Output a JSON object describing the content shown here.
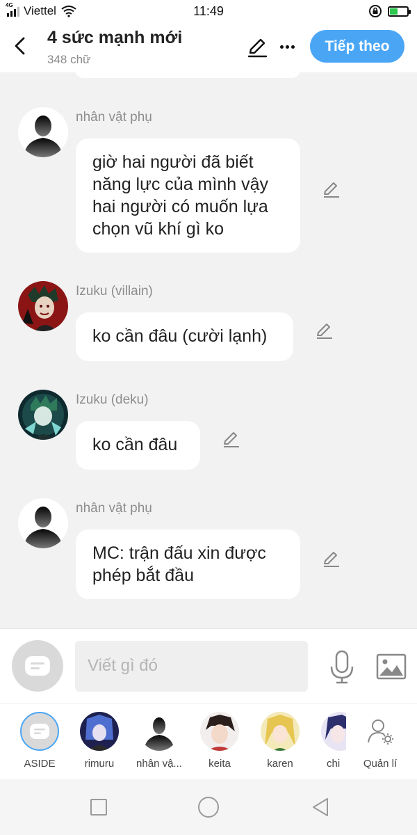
{
  "status_bar": {
    "network_type": "4G",
    "carrier": "Viettel",
    "time": "11:49",
    "battery_fill_fraction": 0.45,
    "battery_color": "#2dc84d"
  },
  "header": {
    "title": "4 sức mạnh mới",
    "word_count": "348 chữ",
    "next_label": "Tiếp theo",
    "accent_color": "#4aa6f5"
  },
  "messages": [
    {
      "speaker": "nhân vật phụ",
      "avatar_icon": "silhouette-avatar",
      "lines": [
        "giờ hai người đã biết",
        "năng lực của mình vậy",
        "hai người có muốn lựa",
        "chọn vũ khí gì ko"
      ]
    },
    {
      "speaker": "Izuku (villain)",
      "avatar_icon": "izuku-villain-avatar",
      "lines": [
        "ko cần đâu (cười lạnh)"
      ]
    },
    {
      "speaker": "Izuku (deku)",
      "avatar_icon": "izuku-deku-avatar",
      "lines": [
        "ko cần đâu"
      ]
    },
    {
      "speaker": "nhân vật phụ",
      "avatar_icon": "silhouette-avatar",
      "lines": [
        "MC: trận đấu xin được",
        "phép bắt đầu"
      ]
    }
  ],
  "composer": {
    "placeholder": "Viết gì đó"
  },
  "characters": [
    {
      "name": "ASIDE",
      "icon": "aside-icon"
    },
    {
      "name": "rimuru",
      "icon": "rimuru-avatar"
    },
    {
      "name": "nhân vậ...",
      "icon": "silhouette-avatar"
    },
    {
      "name": "keita",
      "icon": "keita-avatar"
    },
    {
      "name": "karen",
      "icon": "karen-avatar"
    },
    {
      "name": "chi",
      "icon": "chi-avatar"
    },
    {
      "name": "Quản lí",
      "icon": "manage-characters-icon"
    }
  ]
}
